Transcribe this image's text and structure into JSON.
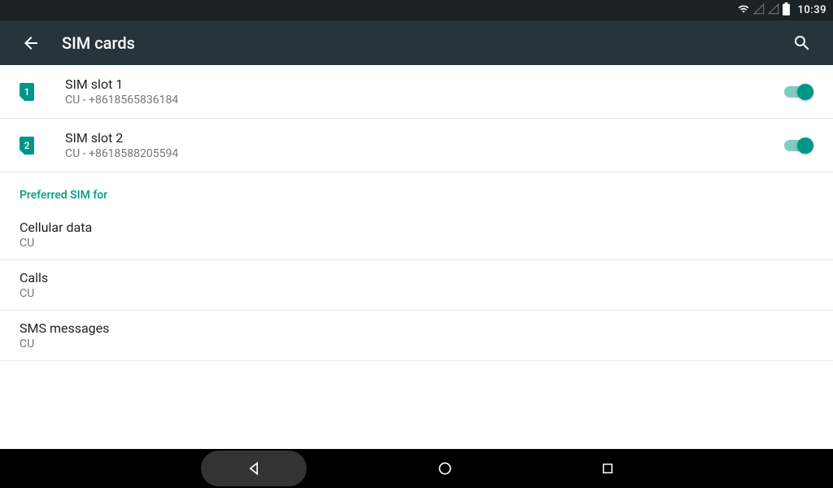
{
  "status": {
    "time": "10:39"
  },
  "appbar": {
    "title": "SIM cards"
  },
  "sims": [
    {
      "badge": "1",
      "title": "SIM slot 1",
      "sub": "CU - +8618565836184"
    },
    {
      "badge": "2",
      "title": "SIM slot 2",
      "sub": "CU - +8618588205594"
    }
  ],
  "section_header": "Preferred SIM for",
  "prefs": [
    {
      "title": "Cellular data",
      "sub": "CU"
    },
    {
      "title": "Calls",
      "sub": "CU"
    },
    {
      "title": "SMS messages",
      "sub": "CU"
    }
  ]
}
